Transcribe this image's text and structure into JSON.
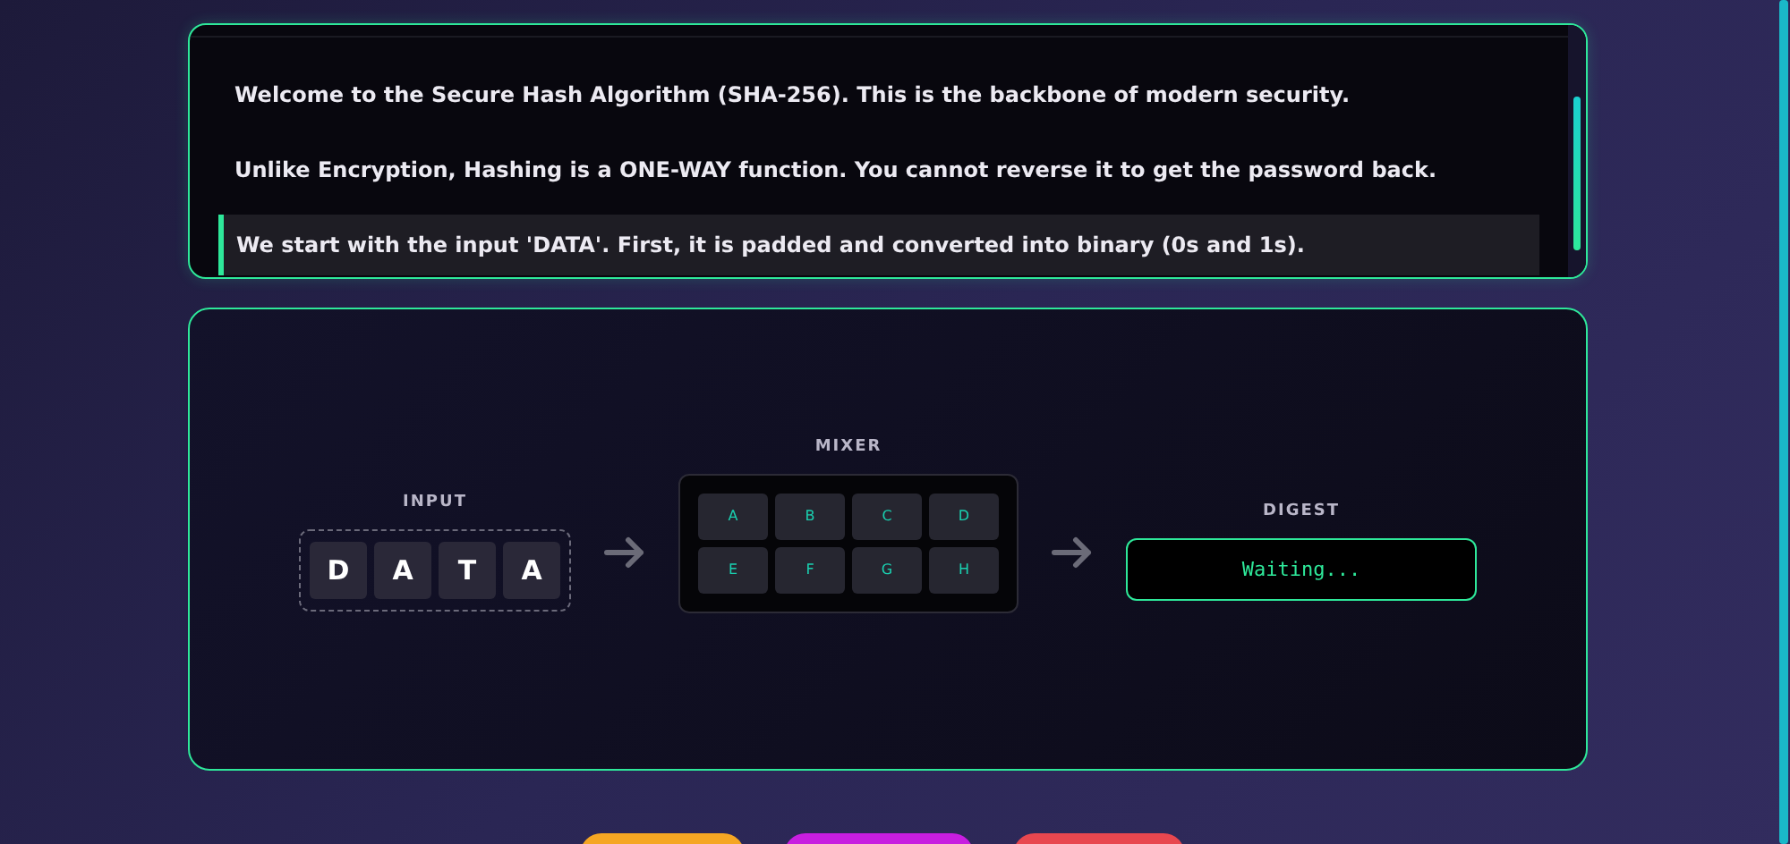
{
  "log": {
    "messages": [
      {
        "text": "Welcome to the Secure Hash Algorithm (SHA-256). This is the backbone of modern security.",
        "selected": false
      },
      {
        "text": "Unlike Encryption, Hashing is a ONE-WAY function. You cannot reverse it to get the password back.",
        "selected": false
      },
      {
        "text": "We start with the input 'DATA'. First, it is padded and converted into binary (0s and 1s).",
        "selected": true
      }
    ]
  },
  "visual": {
    "input": {
      "label": "INPUT",
      "chars": [
        "D",
        "A",
        "T",
        "A"
      ]
    },
    "mixer": {
      "label": "MIXER",
      "cells": [
        "A",
        "B",
        "C",
        "D",
        "E",
        "F",
        "G",
        "H"
      ]
    },
    "digest": {
      "label": "DIGEST",
      "value": "Waiting..."
    }
  },
  "buttons": [
    {
      "color": "#f5a623"
    },
    {
      "color": "#c81ee0"
    },
    {
      "color": "#e8474f"
    }
  ]
}
